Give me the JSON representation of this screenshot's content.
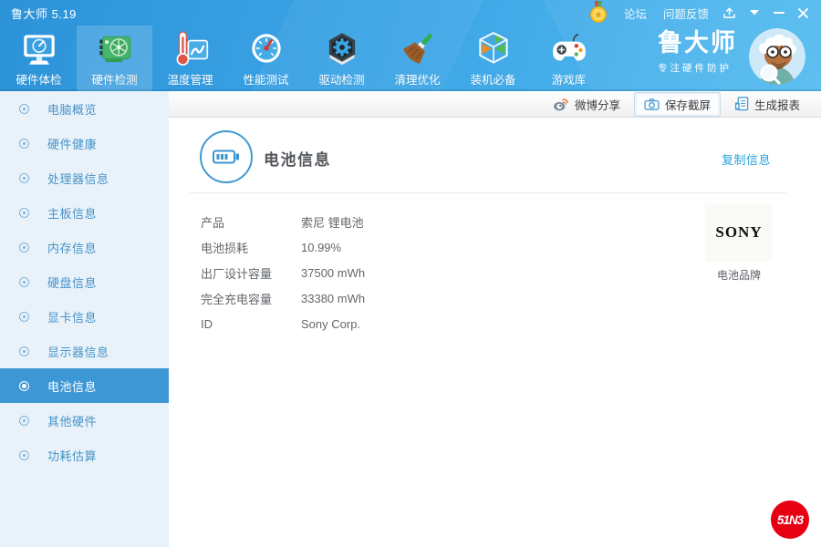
{
  "titlebar": {
    "title": "鲁大师 5.19",
    "forum": "论坛",
    "feedback": "问题反馈",
    "icons": [
      "medal-icon",
      "share-icon",
      "menu-caret-icon",
      "minimize-icon",
      "close-icon"
    ]
  },
  "toolbar": {
    "items": [
      {
        "label": "硬件体检",
        "icon": "monitor-checkup-icon",
        "selected": false
      },
      {
        "label": "硬件检测",
        "icon": "gpu-card-icon",
        "selected": true
      },
      {
        "label": "温度管理",
        "icon": "thermometer-chart-icon",
        "selected": false
      },
      {
        "label": "性能测试",
        "icon": "speed-gauge-icon",
        "selected": false
      },
      {
        "label": "驱动检测",
        "icon": "gear-hexagon-icon",
        "selected": false
      },
      {
        "label": "清理优化",
        "icon": "broom-icon",
        "selected": false
      },
      {
        "label": "装机必备",
        "icon": "software-cube-icon",
        "selected": false
      },
      {
        "label": "游戏库",
        "icon": "gamepad-icon",
        "selected": false
      }
    ],
    "brand_name": "鲁大师",
    "brand_slogan": "专注硬件防护",
    "avatar": "mascot-avatar"
  },
  "actionbar": {
    "weibo": "微博分享",
    "screenshot": "保存截屏",
    "report": "生成报表"
  },
  "sidebar": {
    "items": [
      {
        "label": "电脑概览",
        "selected": false
      },
      {
        "label": "硬件健康",
        "selected": false
      },
      {
        "label": "处理器信息",
        "selected": false
      },
      {
        "label": "主板信息",
        "selected": false
      },
      {
        "label": "内存信息",
        "selected": false
      },
      {
        "label": "硬盘信息",
        "selected": false
      },
      {
        "label": "显卡信息",
        "selected": false
      },
      {
        "label": "显示器信息",
        "selected": false
      },
      {
        "label": "电池信息",
        "selected": true
      },
      {
        "label": "其他硬件",
        "selected": false
      },
      {
        "label": "功耗估算",
        "selected": false
      }
    ]
  },
  "content": {
    "title": "电池信息",
    "copy_link": "复制信息",
    "fields": [
      {
        "label": "产品",
        "value": "索尼 锂电池"
      },
      {
        "label": "电池损耗",
        "value": "10.99%"
      },
      {
        "label": "出厂设计容量",
        "value": "37500 mWh"
      },
      {
        "label": "完全充电容量",
        "value": "33380 mWh"
      },
      {
        "label": "ID",
        "value": "Sony Corp."
      }
    ],
    "brand_logo_text": "SONY",
    "brand_caption": "电池品牌"
  },
  "watermark": "51N3",
  "colors": {
    "header_gradient_start": "#2d93d9",
    "header_gradient_end": "#55bcef",
    "sidebar_bg": "#e9f2f9",
    "sidebar_text": "#4793c9",
    "selected_bg": "#3d97d5",
    "accent_blue": "#3a96cc",
    "link_blue": "#2aa3db",
    "watermark_red": "#e60012"
  }
}
